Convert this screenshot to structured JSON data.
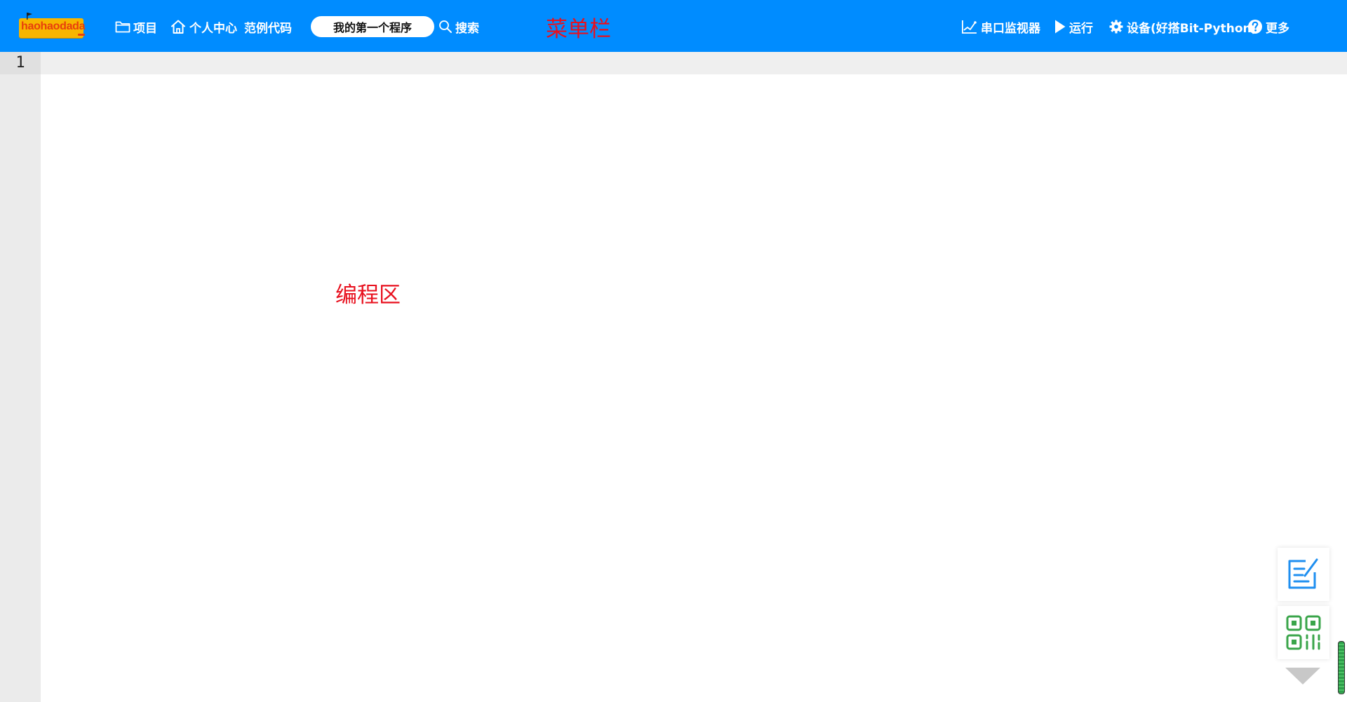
{
  "logo": {
    "text": "haohaodada"
  },
  "menubar": {
    "project_label": "项目",
    "personal_center_label": "个人中心",
    "examples_label": "范例代码",
    "project_name": "我的第一个程序",
    "search_label": "搜索",
    "serial_monitor_label": "串口监视器",
    "run_label": "运行",
    "device_label": "设备(好搭Bit-Python)",
    "more_label": "更多"
  },
  "annotations": {
    "menubar": "菜单栏",
    "editor": "编程区"
  },
  "editor": {
    "line_numbers": [
      "1"
    ]
  },
  "colors": {
    "menubar_bg": "#008cff",
    "annotation": "#e8101e",
    "gutter_bg": "#ebebeb"
  },
  "icons": {
    "project": "folder-icon",
    "personal_center": "home-icon",
    "search": "search-icon",
    "serial_monitor": "serial-chart-icon",
    "run": "play-icon",
    "device": "gear-icon",
    "more": "help-icon",
    "float_top": "edit-note-icon",
    "float_bottom": "qr-code-icon"
  }
}
